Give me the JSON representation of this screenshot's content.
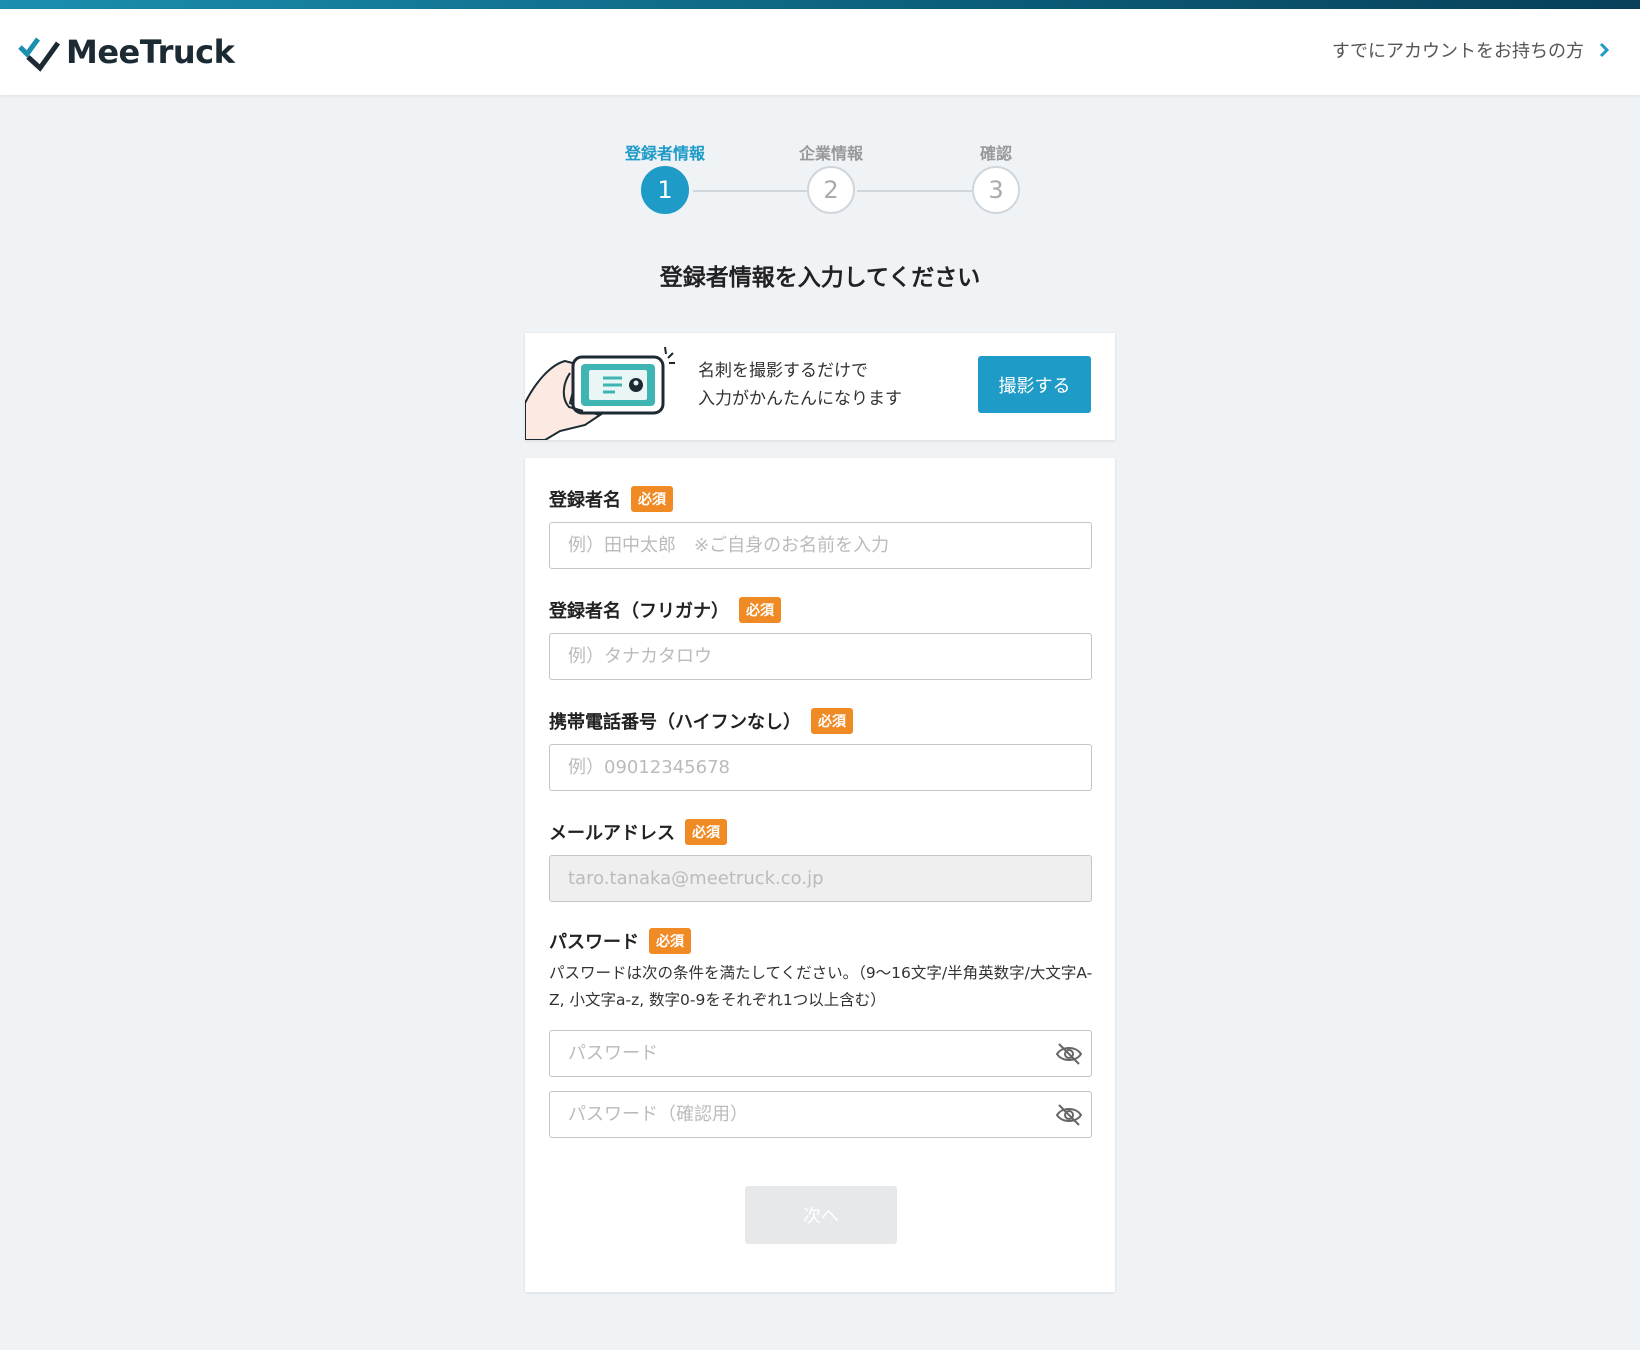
{
  "header": {
    "brand": "MeeTruck",
    "login_link": "すでにアカウントをお持ちの方"
  },
  "stepper": {
    "steps": [
      {
        "label": "登録者情報",
        "number": "1",
        "active": true
      },
      {
        "label": "企業情報",
        "number": "2",
        "active": false
      },
      {
        "label": "確認",
        "number": "3",
        "active": false
      }
    ]
  },
  "page": {
    "title": "登録者情報を入力してください"
  },
  "scan": {
    "line1": "名刺を撮影するだけで",
    "line2": "入力がかんたんになります",
    "button": "撮影する"
  },
  "form": {
    "required_badge": "必須",
    "name": {
      "label": "登録者名",
      "placeholder": "例）田中太郎　※ご自身のお名前を入力"
    },
    "kana": {
      "label": "登録者名（フリガナ）",
      "placeholder": "例）タナカタロウ"
    },
    "phone": {
      "label": "携帯電話番号（ハイフンなし）",
      "placeholder": "例）09012345678"
    },
    "email": {
      "label": "メールアドレス",
      "placeholder": "taro.tanaka@meetruck.co.jp"
    },
    "password": {
      "label": "パスワード",
      "help": "パスワードは次の条件を満たしてください。（9〜16文字/半角英数字/大文字A-Z, 小文字a-z, 数字0-9をそれぞれ1つ以上含む）",
      "placeholder": "パスワード",
      "confirm_placeholder": "パスワード（確認用）"
    },
    "next_button": "次へ"
  },
  "colors": {
    "accent": "#1f9bc8",
    "required": "#f08a24",
    "background": "#f0f3f6"
  },
  "icons": {
    "logo": "meetruck-check-logo-icon",
    "chevron": "chevron-right-icon",
    "eye": "eye-slash-icon",
    "illustration": "phone-scanning-card-icon"
  }
}
